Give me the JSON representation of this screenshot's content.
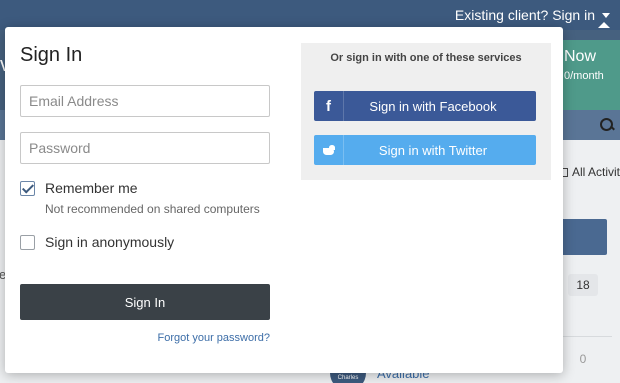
{
  "header": {
    "client_link": "Existing client? Sign in"
  },
  "hero": {
    "edge_letter": "v",
    "cta_label": "Now",
    "cta_sub": "0/month"
  },
  "feed": {
    "all_activity": "All Activit",
    "count_top": "18",
    "count_bottom": "0",
    "avatar_text": "Charles",
    "status_link": "Available",
    "left_edge_text": "e"
  },
  "signin": {
    "title": "Sign In",
    "email_placeholder": "Email Address",
    "password_placeholder": "Password",
    "remember_label": "Remember me",
    "remember_checked": true,
    "remember_hint": "Not recommended on shared computers",
    "anonymous_label": "Sign in anonymously",
    "anonymous_checked": false,
    "submit_label": "Sign In",
    "forgot_link": "Forgot your password?"
  },
  "services": {
    "title": "Or sign in with one of these services",
    "facebook_label": "Sign in with Facebook",
    "facebook_icon": "facebook-icon",
    "facebook_glyph": "f",
    "twitter_label": "Sign in with Twitter",
    "twitter_icon": "twitter-icon"
  },
  "colors": {
    "brand_dark": "#3d5a7e",
    "facebook": "#3b5998",
    "twitter": "#55acee",
    "submit": "#3a4147",
    "link": "#3d6ea8"
  }
}
